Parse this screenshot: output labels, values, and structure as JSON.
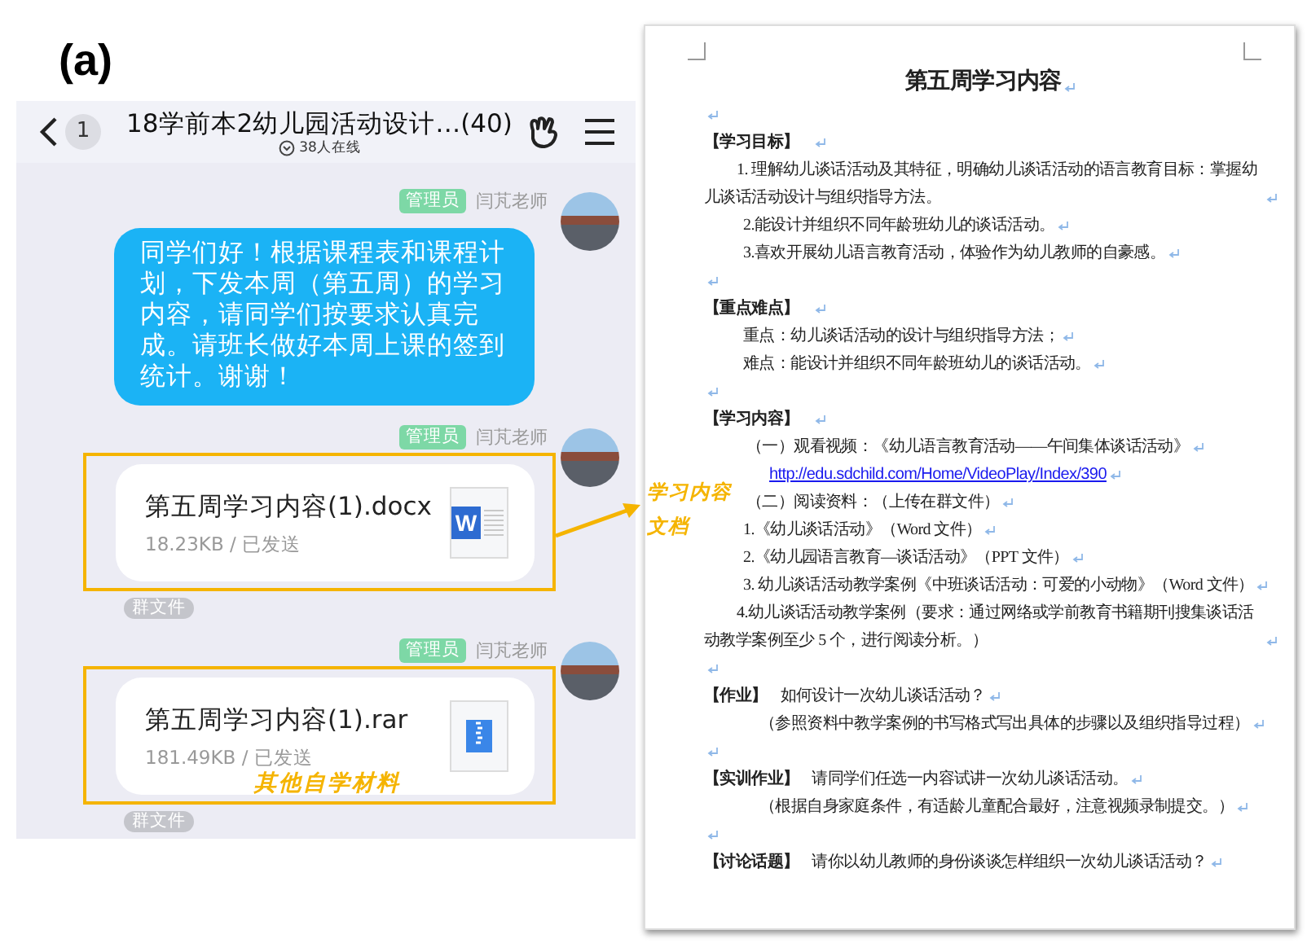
{
  "figure_label": "(a)",
  "chat": {
    "header": {
      "unread": "1",
      "title": "18学前本2幼儿园活动设计…(40)",
      "online": "38人在线"
    },
    "messages": [
      {
        "kind": "text",
        "badge": "管理员",
        "sender": "闫芃老师",
        "text": "同学们好！根据课程表和课程计划，下发本周（第五周）的学习内容，请同学们按要求认真完成。请班长做好本周上课的签到统计。谢谢！"
      },
      {
        "kind": "word_file",
        "badge": "管理员",
        "sender": "闫芃老师",
        "icon_text": "W",
        "name": "第五周学习内容(1).docx",
        "meta": "18.23KB / 已发送",
        "tag": "群文件"
      },
      {
        "kind": "archive_file",
        "badge": "管理员",
        "sender": "闫芃老师",
        "name": "第五周学习内容(1).rar",
        "meta": "181.49KB / 已发送",
        "tag": "群文件"
      }
    ]
  },
  "annotations": [
    {
      "label": "学习内容文档",
      "arrow": true
    },
    {
      "label": "其他自学材料",
      "arrow": false
    }
  ],
  "document": {
    "paragraphs": [
      {
        "kind": "title",
        "text": "第五周学习内容"
      },
      {
        "kind": "blank"
      },
      {
        "kind": "heading",
        "label": "【学习目标】"
      },
      {
        "kind": "wrap",
        "text": "1. 理解幼儿谈话活动及其特征，明确幼儿谈话活动的语言教育目标：掌握幼儿谈话活动设计与组织指导方法。"
      },
      {
        "kind": "item",
        "text": "2.能设计并组织不同年龄班幼儿的谈话活动。"
      },
      {
        "kind": "item",
        "text": "3.喜欢开展幼儿语言教育活动，体验作为幼儿教师的自豪感。"
      },
      {
        "kind": "blank"
      },
      {
        "kind": "heading",
        "label": "【重点难点】"
      },
      {
        "kind": "item",
        "text": "重点：幼儿谈话活动的设计与组织指导方法；"
      },
      {
        "kind": "item",
        "text": "难点：能设计并组织不同年龄班幼儿的谈话活动。"
      },
      {
        "kind": "blank"
      },
      {
        "kind": "heading",
        "label": "【学习内容】"
      },
      {
        "kind": "sub",
        "text": "（一）观看视频：《幼儿语言教育活动——午间集体谈话活动》"
      },
      {
        "kind": "link",
        "text": "http://edu.sdchild.com/Home/VideoPlay/Index/390"
      },
      {
        "kind": "sub",
        "text": "（二）阅读资料：（上传在群文件）"
      },
      {
        "kind": "item",
        "text": "1.《幼儿谈话活动》（Word 文件）"
      },
      {
        "kind": "item",
        "text": "2.《幼儿园语言教育—谈话活动》（PPT 文件）"
      },
      {
        "kind": "item",
        "text": "3. 幼儿谈话活动教学案例《中班谈话活动：可爱的小动物》（Word 文件）"
      },
      {
        "kind": "wrap",
        "text": "4.幼儿谈话活动教学案例（要求：通过网络或学前教育书籍期刊搜集谈话活动教学案例至少 5 个，进行阅读分析。）"
      },
      {
        "kind": "blank"
      },
      {
        "kind": "labeled",
        "label": "【作业】",
        "text": "如何设计一次幼儿谈话活动？"
      },
      {
        "kind": "note",
        "text": "（参照资料中教学案例的书写格式写出具体的步骤以及组织指导过程）"
      },
      {
        "kind": "blank"
      },
      {
        "kind": "labeled",
        "label": "【实训作业】",
        "text": "请同学们任选一内容试讲一次幼儿谈话活动。"
      },
      {
        "kind": "note",
        "text": "（根据自身家庭条件，有适龄儿童配合最好，注意视频录制提交。）"
      },
      {
        "kind": "blank"
      },
      {
        "kind": "labeled",
        "label": "【讨论话题】",
        "text": "请你以幼儿教师的身份谈谈怎样组织一次幼儿谈话活动？"
      }
    ]
  }
}
